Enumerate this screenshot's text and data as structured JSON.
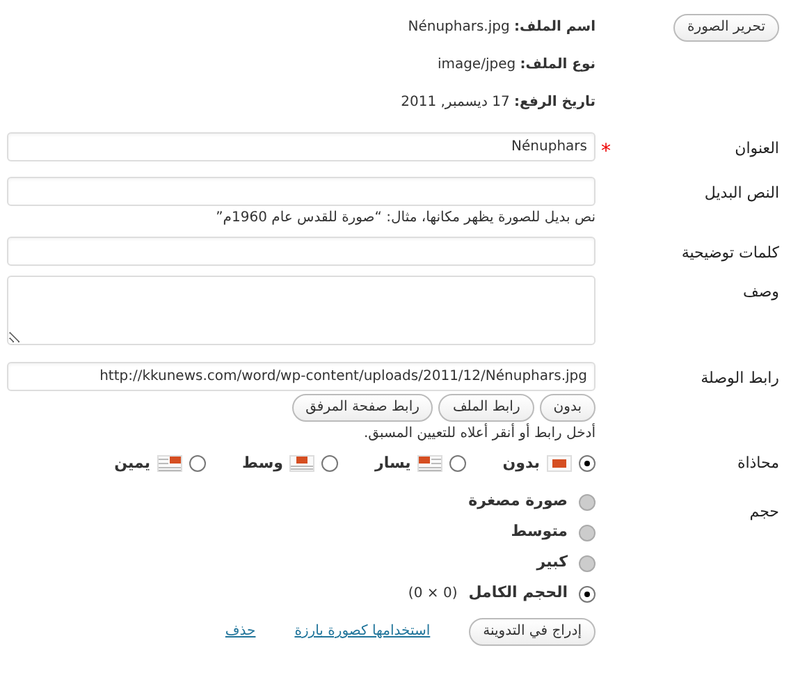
{
  "edit_image_button": "تحرير الصورة",
  "file_info": [
    {
      "label": "اسم الملف:",
      "value": "Nénuphars.jpg"
    },
    {
      "label": "نوع الملف:",
      "value": "image/jpeg"
    },
    {
      "label": "تاريخ الرفع:",
      "value": "17 ديسمبر, 2011"
    }
  ],
  "fields": [
    {
      "kind": "text",
      "label": "العنوان",
      "required_mark": "*",
      "value": "Nénuphars"
    },
    {
      "kind": "text",
      "label": "النص البديل",
      "help": "نص بديل للصورة يظهر مكانها، مثال: “صورة للقدس عام 1960م”"
    },
    {
      "kind": "text",
      "label": "كلمات توضيحية"
    },
    {
      "kind": "textarea",
      "label": "وصف"
    },
    {
      "kind": "url",
      "label": "رابط الوصلة",
      "value": "http://kkunews.com/word/wp-content/uploads/2011/12/Nénuphars.jpg",
      "buttons": [
        "بدون",
        "رابط الملف",
        "رابط صفحة المرفق"
      ],
      "help": "أدخل رابط أو أنقر أعلاه للتعيين المسبق."
    }
  ],
  "alignment": {
    "label": "محاذاة",
    "options": [
      {
        "kind": "none",
        "label": "بدون",
        "selected": true
      },
      {
        "kind": "left",
        "label": "يسار",
        "selected": false
      },
      {
        "kind": "center",
        "label": "وسط",
        "selected": false
      },
      {
        "kind": "right",
        "label": "يمين",
        "selected": false
      }
    ]
  },
  "size": {
    "label": "حجم",
    "options": [
      {
        "label": "صورة مصغرة",
        "selected": false,
        "disabled": true
      },
      {
        "label": "متوسط",
        "selected": false,
        "disabled": true
      },
      {
        "label": "كبير",
        "selected": false,
        "disabled": true
      },
      {
        "label": "الحجم الكامل",
        "dimensions": "(0 × 0)",
        "selected": true,
        "disabled": false
      }
    ]
  },
  "actions": {
    "insert_button": "إدراج في التدوينة",
    "links": [
      "استخدامها كصورة بارزة",
      "حذف"
    ]
  }
}
